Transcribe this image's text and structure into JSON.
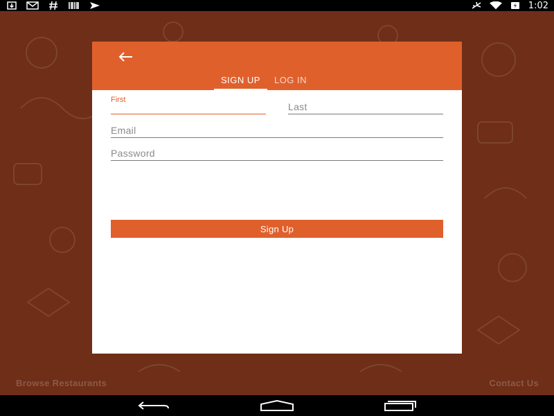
{
  "status_bar": {
    "time": "1:02",
    "left_icons": [
      "download-icon",
      "gmail-icon",
      "hashtag-icon",
      "barcode-icon",
      "paper-plane-icon"
    ],
    "right_icons": [
      "airplane-mode-icon",
      "wifi-icon",
      "battery-charging-icon"
    ]
  },
  "card": {
    "tabs": [
      {
        "label": "SIGN UP",
        "active": true
      },
      {
        "label": "LOG IN",
        "active": false
      }
    ],
    "form": {
      "first_label": "First",
      "first_value": "",
      "last_placeholder": "Last",
      "email_placeholder": "Email",
      "password_placeholder": "Password",
      "submit_label": "Sign Up"
    }
  },
  "footer": {
    "browse_label": "Browse Restaurants",
    "contact_label": "Contact Us"
  },
  "colors": {
    "accent": "#e0602c",
    "background": "#6e2e18",
    "card": "#ffffff"
  }
}
